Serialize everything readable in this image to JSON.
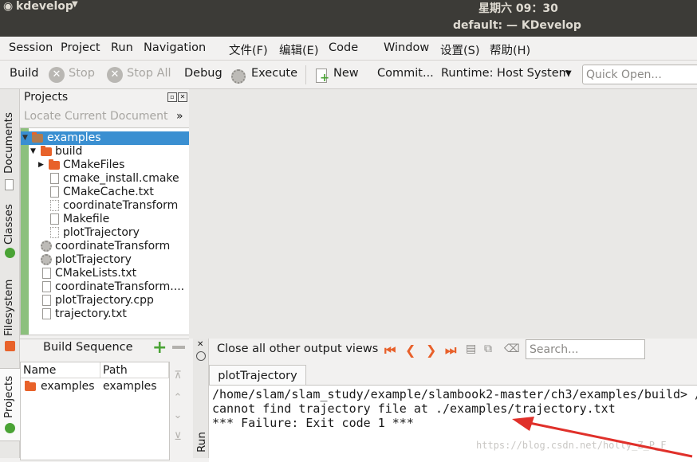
{
  "topbar": {
    "app_menu": "kdevelop",
    "clock": "星期六 09：30",
    "window_title": "default:  — KDevelop"
  },
  "menubar": [
    "Session",
    "Project",
    "Run",
    "Navigation",
    "文件(F)",
    "编辑(E)",
    "Code",
    "Window",
    "设置(S)",
    "帮助(H)"
  ],
  "toolbar": {
    "build": "Build",
    "stop": "Stop",
    "stop_all": "Stop All",
    "debug": "Debug",
    "execute": "Execute",
    "new": "New",
    "commit": "Commit...",
    "runtime": "Runtime: Host System",
    "quick_open_placeholder": "Quick Open..."
  },
  "side_tabs": [
    "Documents",
    "Classes",
    "Filesystem",
    "Projects"
  ],
  "projects": {
    "title": "Projects",
    "locate": "Locate Current Document",
    "more": "»",
    "tree": [
      {
        "label": "examples",
        "depth": 0,
        "type": "folder",
        "expanded": true,
        "selected": true
      },
      {
        "label": "build",
        "depth": 1,
        "type": "folder",
        "expanded": true
      },
      {
        "label": "CMakeFiles",
        "depth": 2,
        "type": "folder",
        "expanded": false
      },
      {
        "label": "cmake_install.cmake",
        "depth": 2,
        "type": "file"
      },
      {
        "label": "CMakeCache.txt",
        "depth": 2,
        "type": "file"
      },
      {
        "label": "coordinateTransform",
        "depth": 2,
        "type": "exec"
      },
      {
        "label": "Makefile",
        "depth": 2,
        "type": "file"
      },
      {
        "label": "plotTrajectory",
        "depth": 2,
        "type": "exec"
      },
      {
        "label": "coordinateTransform",
        "depth": 1,
        "type": "gear"
      },
      {
        "label": "plotTrajectory",
        "depth": 1,
        "type": "gear"
      },
      {
        "label": "CMakeLists.txt",
        "depth": 1,
        "type": "file"
      },
      {
        "label": "coordinateTransform....",
        "depth": 1,
        "type": "file"
      },
      {
        "label": "plotTrajectory.cpp",
        "depth": 1,
        "type": "file"
      },
      {
        "label": "trajectory.txt",
        "depth": 1,
        "type": "file"
      }
    ]
  },
  "build_sequence": {
    "title": "Build Sequence",
    "columns": [
      "Name",
      "Path"
    ],
    "rows": [
      {
        "name": "examples",
        "path": "examples"
      }
    ]
  },
  "run": {
    "side_label": "Run",
    "close_all": "Close all other output views",
    "search_placeholder": "Search...",
    "tab": "plotTrajectory",
    "output_lines": [
      "/home/slam/slam_study/example/slambook2-master/ch3/examples/build> /",
      "cannot find trajectory file at ./examples/trajectory.txt",
      "*** Failure: Exit code 1 ***"
    ],
    "watermark": "https://blog.csdn.net/holly_Z_P_F"
  },
  "colors": {
    "accent": "#3a8fd1",
    "arrow": "#e0302a",
    "folder": "#e8622a"
  }
}
